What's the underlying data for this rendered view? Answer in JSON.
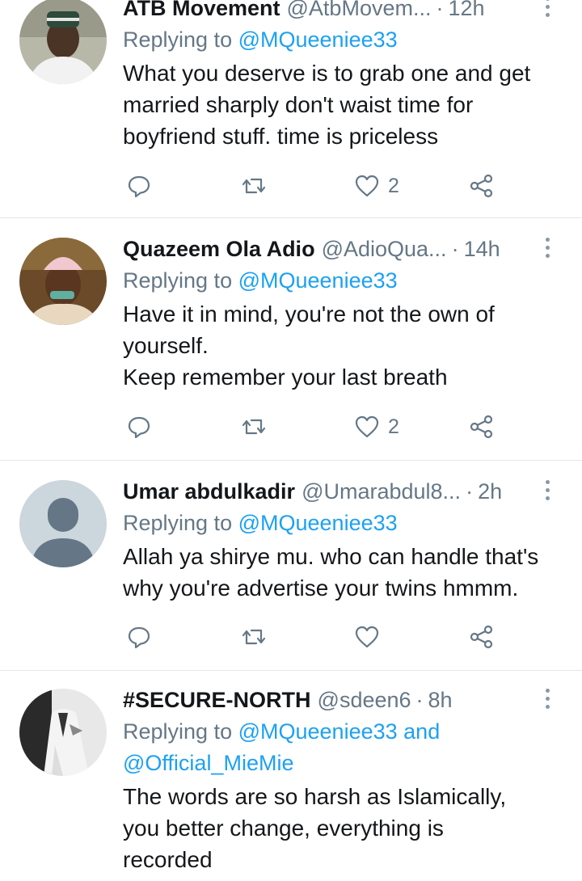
{
  "tweets": [
    {
      "name": "ATB Movement",
      "handle": "@AtbMovem...",
      "time": "12h",
      "replying_prefix": "Replying to",
      "replying_to": "@MQueeniee33",
      "replying_and": "",
      "replying_second": "",
      "text": [
        "What you deserve is to grab one and get",
        "married sharply don't waist time for",
        "boyfriend stuff. time is priceless"
      ],
      "likes": "2"
    },
    {
      "name": "Quazeem Ola Adio",
      "handle": "@AdioQua...",
      "time": "14h",
      "replying_prefix": "Replying to",
      "replying_to": "@MQueeniee33",
      "replying_and": "",
      "replying_second": "",
      "text": [
        "Have it in mind, you're not the own of",
        "yourself.",
        "Keep remember your last breath"
      ],
      "likes": "2"
    },
    {
      "name": "Umar abdulkadir",
      "handle": "@Umarabdul8...",
      "time": "2h",
      "replying_prefix": "Replying to",
      "replying_to": "@MQueeniee33",
      "replying_and": "",
      "replying_second": "",
      "text": [
        "Allah ya shirye mu. who can handle that's",
        "why you're advertise your twins hmmm."
      ],
      "likes": ""
    },
    {
      "name": "#SECURE-NORTH",
      "handle": "@sdeen6",
      "time": "8h",
      "replying_prefix": "Replying to",
      "replying_to": "@MQueeniee33",
      "replying_and": "and",
      "replying_second": "@Official_MieMie",
      "text": [
        "The words are so harsh as Islamically,",
        "you better change, everything is",
        "recorded"
      ],
      "likes": ""
    }
  ],
  "separator": "·",
  "icons": {
    "reply": "reply-icon",
    "retweet": "retweet-icon",
    "like": "heart-icon",
    "share": "share-icon",
    "more": "more-vertical-icon"
  },
  "colors": {
    "link": "#1da1f2",
    "secondary": "#657786",
    "icon": "#657786",
    "divider": "#e1e8ed"
  }
}
